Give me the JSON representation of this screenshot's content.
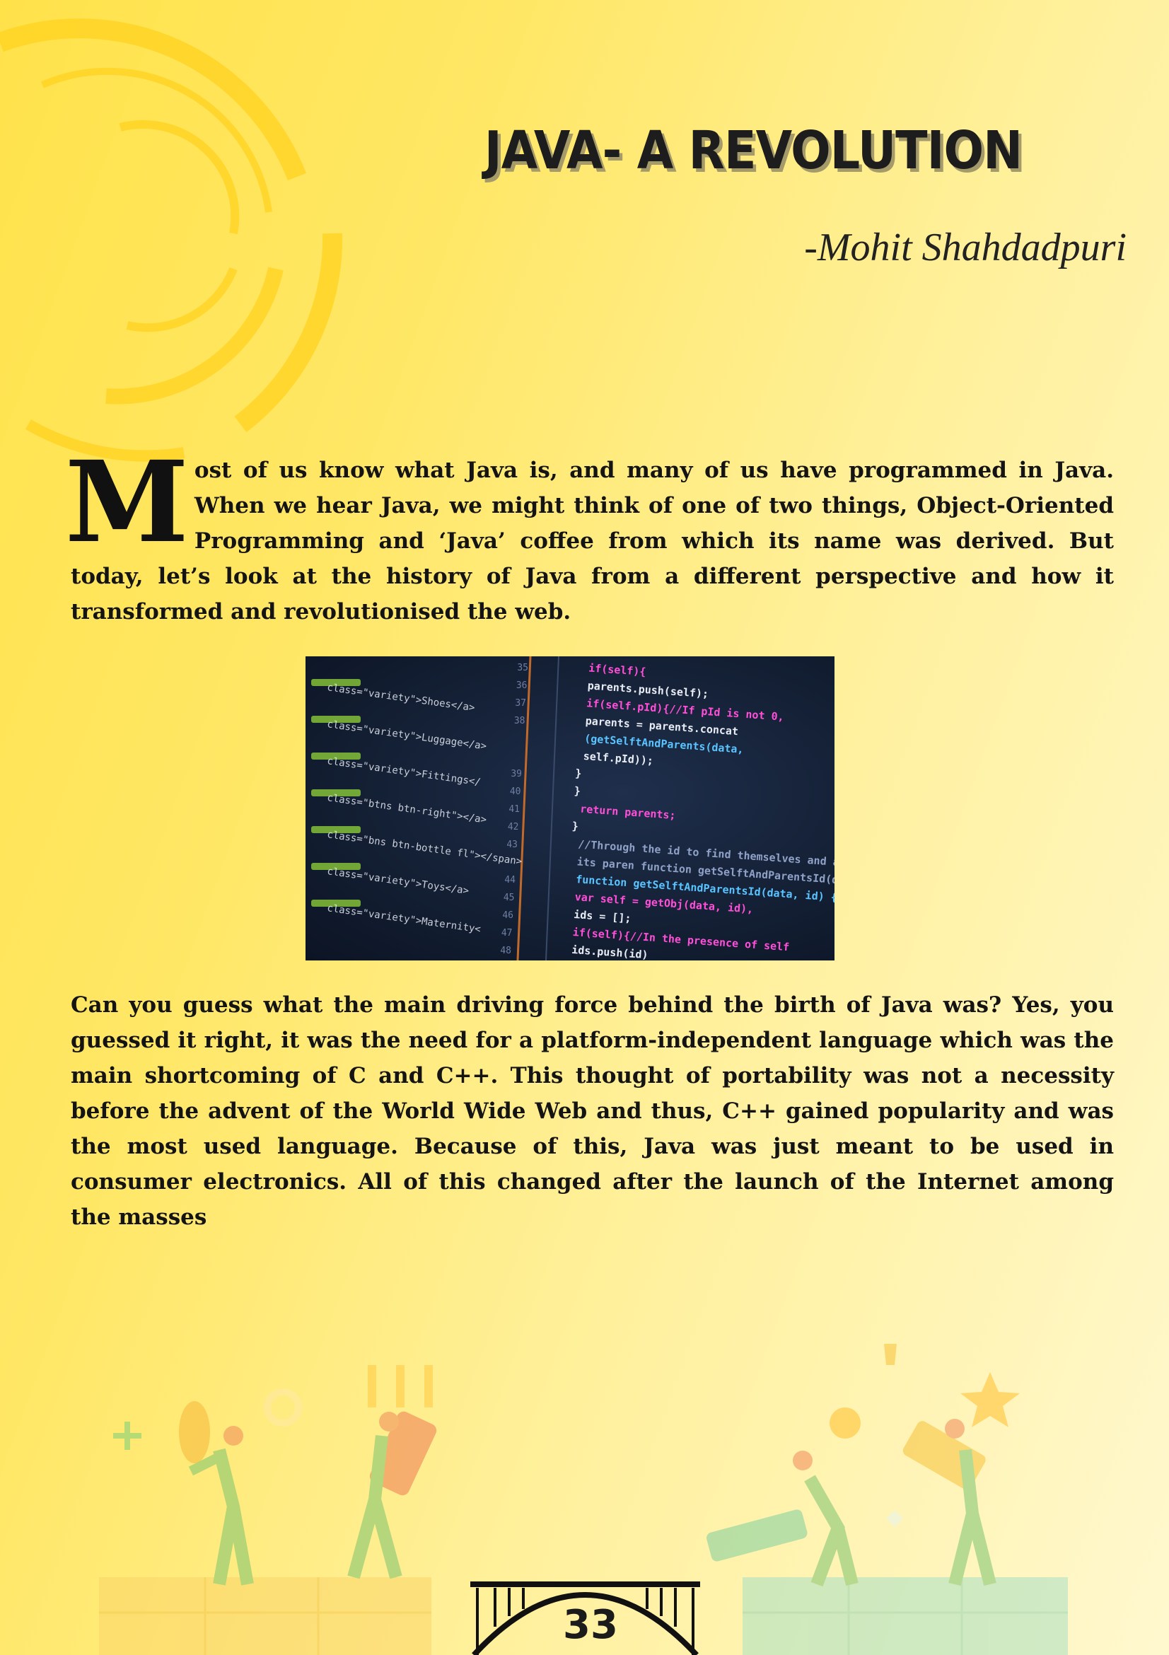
{
  "article": {
    "title": "JAVA- A REVOLUTION",
    "author": "-Mohit Shahdadpuri",
    "drop_cap": "M",
    "paragraph_1_rest": "ost of us know what Java is, and many of us have programmed in Java. When we hear Java, we might think of one of two things, Object-Oriented Programming and ‘Java’ coffee from which its name was derived. But today, let’s look at the history of Java from a different perspective and how it transformed and revolutionised the web.",
    "paragraph_2": "Can you guess what the main driving force behind the birth of Java was? Yes, you guessed it right, it was the need for a platform-independent language which was the main shortcoming of C and C++. This thought of portability was not a necessity before the advent of the World Wide Web and thus, C++ gained popularity and was the most used language. Because of this, Java was just meant to be used in consumer electronics. All of this changed after the launch of the Internet among the masses"
  },
  "page_number": "33",
  "code_lines": [
    {
      "num": "35",
      "text": "if(self){"
    },
    {
      "num": "36",
      "text": "parents.push(self);"
    },
    {
      "num": "37",
      "text": "if(self.pId){//If pId is not 0,"
    },
    {
      "num": "38",
      "text": "parents = parents.concat"
    },
    {
      "num": "",
      "text": "(getSelftAndParents(data,"
    },
    {
      "num": "",
      "text": "self.pId));"
    },
    {
      "num": "39",
      "text": "}"
    },
    {
      "num": "40",
      "text": "}"
    },
    {
      "num": "41",
      "text": "return parents;"
    },
    {
      "num": "42",
      "text": "}"
    },
    {
      "num": "43",
      "text": "//Through the id to find themselves and all"
    },
    {
      "num": "",
      "text": "its paren function getSelftAndParentsId(data, arg"
    },
    {
      "num": "44",
      "text": "function getSelftAndParentsId(data, id) {"
    },
    {
      "num": "45",
      "text": "var self = getObj(data, id),"
    },
    {
      "num": "46",
      "text": "ids = [];"
    },
    {
      "num": "47",
      "text": "if(self){//In the presence of self"
    },
    {
      "num": "48",
      "text": "ids.push(id)"
    }
  ],
  "html_lines": [
    "class=\"variety\">Shoes</a>",
    "class=\"variety\">Luggage</a>",
    "class=\"variety\">Fittings</",
    "class=\"btns btn-right\"></a>",
    "class=\"bns btn-bottle fl\"></span>",
    "class=\"variety\">Toys</a>",
    "class=\"variety\">Maternity<"
  ],
  "colors": {
    "code_bg": "#142035",
    "code_text": "#e8ecf5",
    "keyword": "#ff4fd8",
    "function": "#59c4ff",
    "string": "#9be33b",
    "comment": "#8fa1c7"
  }
}
